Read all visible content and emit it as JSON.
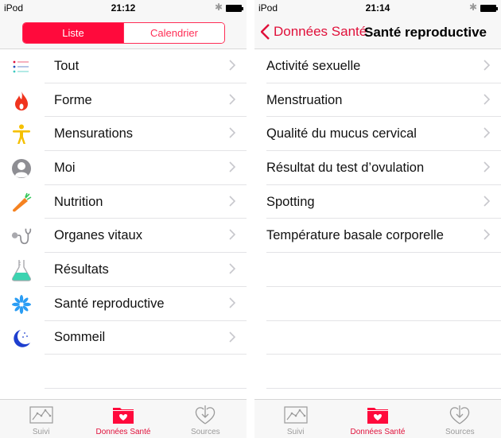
{
  "colors": {
    "accent": "#ff0a3c",
    "accent_text": "#e0103a",
    "separator": "#e3e3e6",
    "tab_inactive": "#9a9a9a",
    "chevron": "#c7c7cc"
  },
  "left_screen": {
    "status": {
      "carrier": "iPod",
      "time": "21:12",
      "bluetooth_icon": "bluetooth-icon",
      "battery_icon": "battery-icon"
    },
    "segmented": {
      "options": [
        "Liste",
        "Calendrier"
      ],
      "selected": "Liste"
    },
    "categories": [
      {
        "label": "Tout",
        "icon": "list-icon"
      },
      {
        "label": "Forme",
        "icon": "flame-icon"
      },
      {
        "label": "Mensurations",
        "icon": "body-icon"
      },
      {
        "label": "Moi",
        "icon": "person-icon"
      },
      {
        "label": "Nutrition",
        "icon": "carrot-icon"
      },
      {
        "label": "Organes vitaux",
        "icon": "stethoscope-icon"
      },
      {
        "label": "Résultats",
        "icon": "flask-icon"
      },
      {
        "label": "Santé reproductive",
        "icon": "snowflake-icon"
      },
      {
        "label": "Sommeil",
        "icon": "moon-icon"
      }
    ]
  },
  "right_screen": {
    "status": {
      "carrier": "iPod",
      "time": "21:14",
      "bluetooth_icon": "bluetooth-icon",
      "battery_icon": "battery-icon"
    },
    "navbar": {
      "back_label": "Données Santé",
      "title": "Santé reproductive"
    },
    "items": [
      {
        "label": "Activité sexuelle"
      },
      {
        "label": "Menstruation"
      },
      {
        "label": "Qualité du mucus cervical"
      },
      {
        "label": "Résultat du test d’ovulation"
      },
      {
        "label": "Spotting"
      },
      {
        "label": "Température basale corporelle"
      }
    ]
  },
  "tabbar": {
    "tabs": [
      {
        "label": "Suivi",
        "icon": "chart-icon",
        "active": false
      },
      {
        "label": "Données Santé",
        "icon": "health-data-folder-icon",
        "active": true
      },
      {
        "label": "Sources",
        "icon": "sources-heart-icon",
        "active": false
      }
    ]
  }
}
